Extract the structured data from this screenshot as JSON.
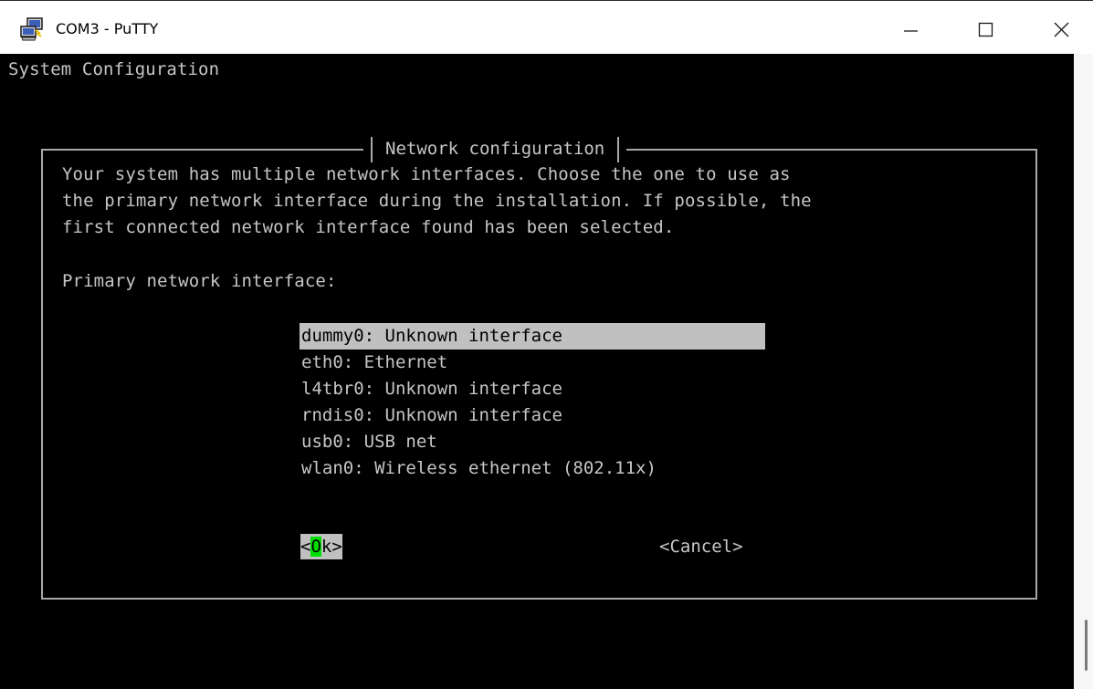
{
  "window": {
    "title": "COM3 - PuTTY",
    "minimize_icon": "minimize-icon",
    "maximize_icon": "maximize-icon",
    "close_icon": "close-icon",
    "app_icon": "putty-computers-icon"
  },
  "terminal": {
    "header": "System Configuration",
    "dialog": {
      "title": "Network configuration",
      "description_lines": [
        "Your system has multiple network interfaces. Choose the one to use as",
        "the primary network interface during the installation. If possible, the",
        "first connected network interface found has been selected."
      ],
      "prompt": "Primary network interface:",
      "interfaces": [
        "dummy0: Unknown interface",
        "eth0: Ethernet",
        "l4tbr0: Unknown interface",
        "rndis0: Unknown interface",
        "usb0: USB net",
        "wlan0: Wireless ethernet (802.11x)"
      ],
      "selected_index": 0,
      "ok_button": {
        "prefix": "<",
        "hotkey": "O",
        "suffix": "k>"
      },
      "cancel_button": "<Cancel>"
    }
  },
  "colors": {
    "terminal_bg": "#000000",
    "terminal_fg": "#c6c6c6",
    "selection_bg": "#c0c0c0",
    "hotkey_bg": "#00e000"
  }
}
